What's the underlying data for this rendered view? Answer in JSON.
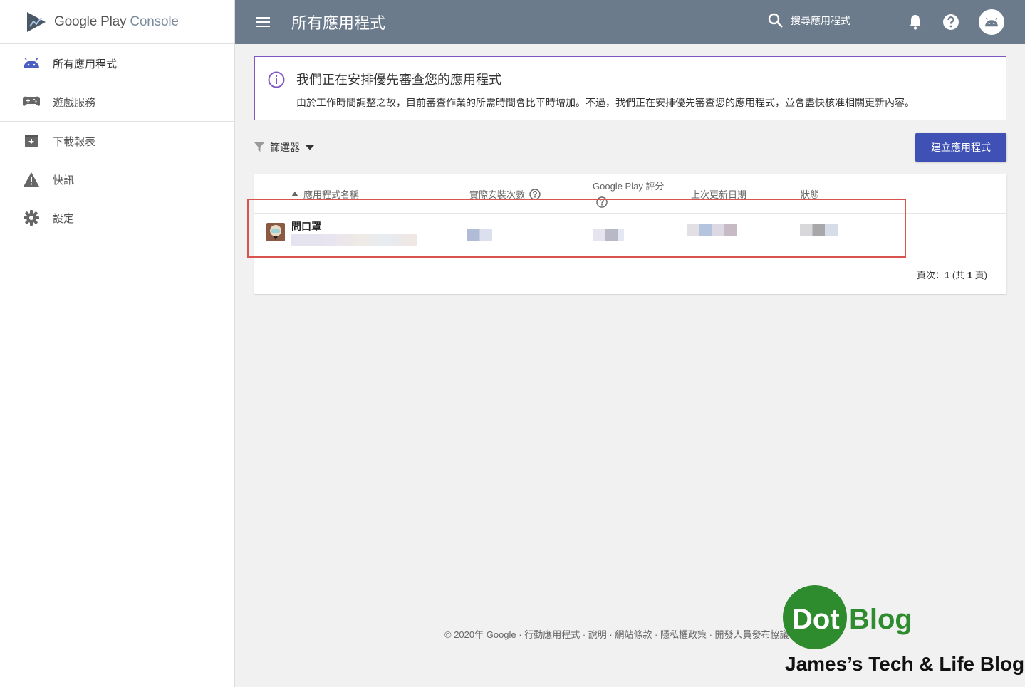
{
  "brand": {
    "name": "Google Play",
    "product": "Console"
  },
  "sidebar": {
    "items": [
      {
        "label": "所有應用程式",
        "icon": "android-icon",
        "active": true
      },
      {
        "label": "遊戲服務",
        "icon": "gamepad-icon"
      },
      {
        "label": "下載報表",
        "icon": "download-box-icon"
      },
      {
        "label": "快訊",
        "icon": "warning-icon"
      },
      {
        "label": "設定",
        "icon": "gear-icon"
      }
    ]
  },
  "header": {
    "title": "所有應用程式",
    "search_label": "搜尋應用程式",
    "color": "#6b7b8c"
  },
  "notice": {
    "title": "我們正在安排優先審查您的應用程式",
    "body": "由於工作時間調整之故，目前審查作業的所需時間會比平時增加。不過，我們正在安排優先審查您的應用程式，並會盡快核准相關更新內容。",
    "border_color": "#7e57c2"
  },
  "toolbar": {
    "filter_label": "篩選器",
    "create_label": "建立應用程式",
    "create_color": "#3f51b5"
  },
  "table": {
    "columns": {
      "name": "應用程式名稱",
      "installs": "實際安裝次數",
      "rating": "Google Play 評分",
      "updated": "上次更新日期",
      "status": "狀態"
    },
    "rows": [
      {
        "name": "問口罩"
      }
    ],
    "pagination": {
      "prefix": "頁次：",
      "current": "1",
      "middle": " (共 ",
      "total": "1",
      "suffix": " 頁)"
    }
  },
  "footer": {
    "copyright": "© 2020年 Google",
    "links": [
      "行動應用程式",
      "說明",
      "網站條款",
      "隱私權政策",
      "開發人員發布協議"
    ]
  },
  "watermark": {
    "dot": "Dot",
    "blog": "Blog",
    "tagline": "James’s Tech & Life Blog"
  },
  "highlight_color": "#d9534f"
}
